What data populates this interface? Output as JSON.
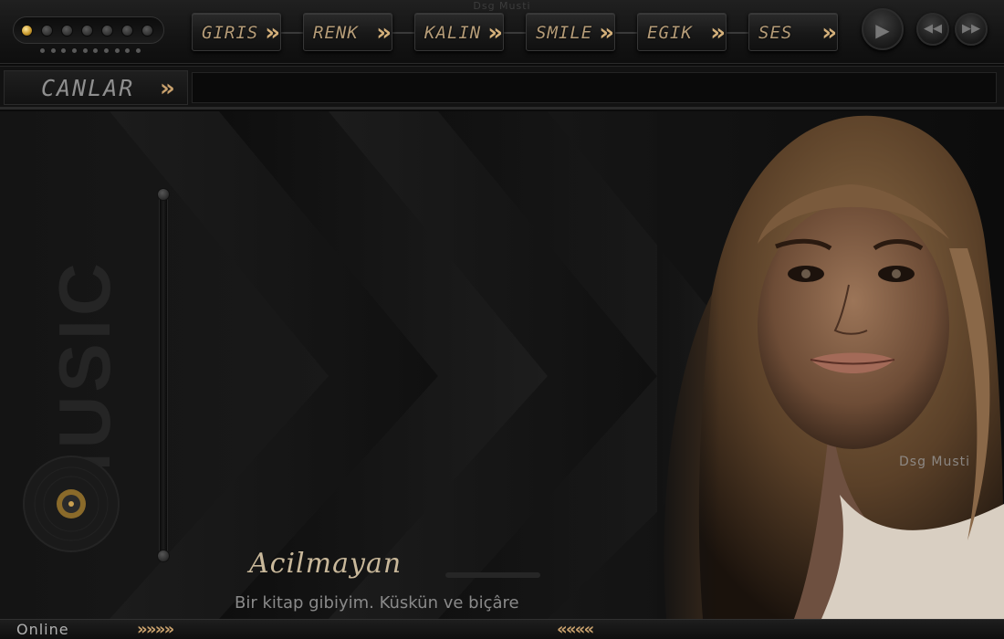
{
  "header": {
    "title": "Dsg Musti",
    "led_count": 7,
    "active_led": 0,
    "nav": [
      {
        "label": "GIRIS",
        "chevron": "»"
      },
      {
        "label": "RENK",
        "chevron": "»"
      },
      {
        "label": "KALIN",
        "chevron": "»"
      },
      {
        "label": "SMILE",
        "chevron": "»"
      },
      {
        "label": "EGIK",
        "chevron": "»"
      },
      {
        "label": "SES",
        "chevron": "»"
      }
    ],
    "controls": {
      "play_icon": "play-icon",
      "rewind_icon": "rewind-icon",
      "forward_icon": "fast-forward-icon"
    }
  },
  "subbar": {
    "label": "CANLAR",
    "chevron": "»"
  },
  "main": {
    "side_word": "MUSIC",
    "watermark": "Dsg Musti",
    "song_title": "Acilmayan",
    "lyric": "Bir kitap gibiyim. Küskün ve biçâre"
  },
  "footer": {
    "status": "Online",
    "arrows_right": "» » » »",
    "arrows_left": "« « « «"
  },
  "colors": {
    "accent": "#c9a16d",
    "background": "#141414",
    "led_on": "#e8b94a"
  }
}
